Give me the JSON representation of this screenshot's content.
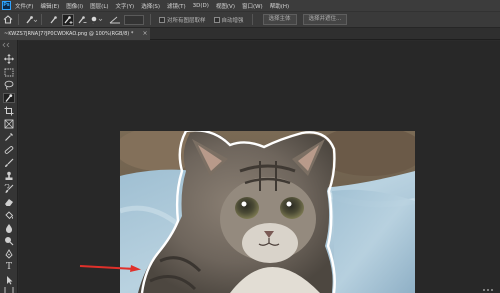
{
  "app": {
    "logo_text": "Ps"
  },
  "menu": [
    {
      "label": "文件(F)"
    },
    {
      "label": "编辑(E)"
    },
    {
      "label": "图像(I)"
    },
    {
      "label": "图层(L)"
    },
    {
      "label": "文字(Y)"
    },
    {
      "label": "选择(S)"
    },
    {
      "label": "滤镜(T)"
    },
    {
      "label": "3D(D)"
    },
    {
      "label": "视图(V)"
    },
    {
      "label": "窗口(W)"
    },
    {
      "label": "帮助(H)"
    }
  ],
  "options": {
    "sample_all_layers_label": "对所有图层取样",
    "auto_enhance_label": "自动增强",
    "select_subject_label": "选择主体",
    "select_and_mask_label": "选择并遮住..."
  },
  "document_tab": {
    "title": "~KWZS7JRNA]7?JP0CWDKAO.png @ 100%(RGB/8) *",
    "close_glyph": "×"
  },
  "tools": [
    {
      "icon": "move-tool-icon"
    },
    {
      "icon": "marquee-tool-icon"
    },
    {
      "icon": "lasso-tool-icon"
    },
    {
      "icon": "quick-selection-tool-icon",
      "active": true
    },
    {
      "icon": "crop-tool-icon"
    },
    {
      "icon": "frame-tool-icon"
    },
    {
      "icon": "eyedropper-tool-icon"
    },
    {
      "icon": "healing-brush-tool-icon"
    },
    {
      "icon": "brush-tool-icon"
    },
    {
      "icon": "clone-stamp-tool-icon"
    },
    {
      "icon": "history-brush-tool-icon"
    },
    {
      "icon": "eraser-tool-icon"
    },
    {
      "icon": "paint-bucket-tool-icon"
    },
    {
      "icon": "blur-tool-icon"
    },
    {
      "icon": "dodge-tool-icon"
    },
    {
      "icon": "pen-tool-icon"
    },
    {
      "icon": "type-tool-icon",
      "glyph": "T"
    },
    {
      "icon": "path-selection-tool-icon"
    },
    {
      "icon": "rectangle-tool-icon"
    }
  ],
  "colors": {
    "accent": "#31a8ff",
    "arrow": "#e0302a",
    "selection_outline": "#ffffff"
  }
}
